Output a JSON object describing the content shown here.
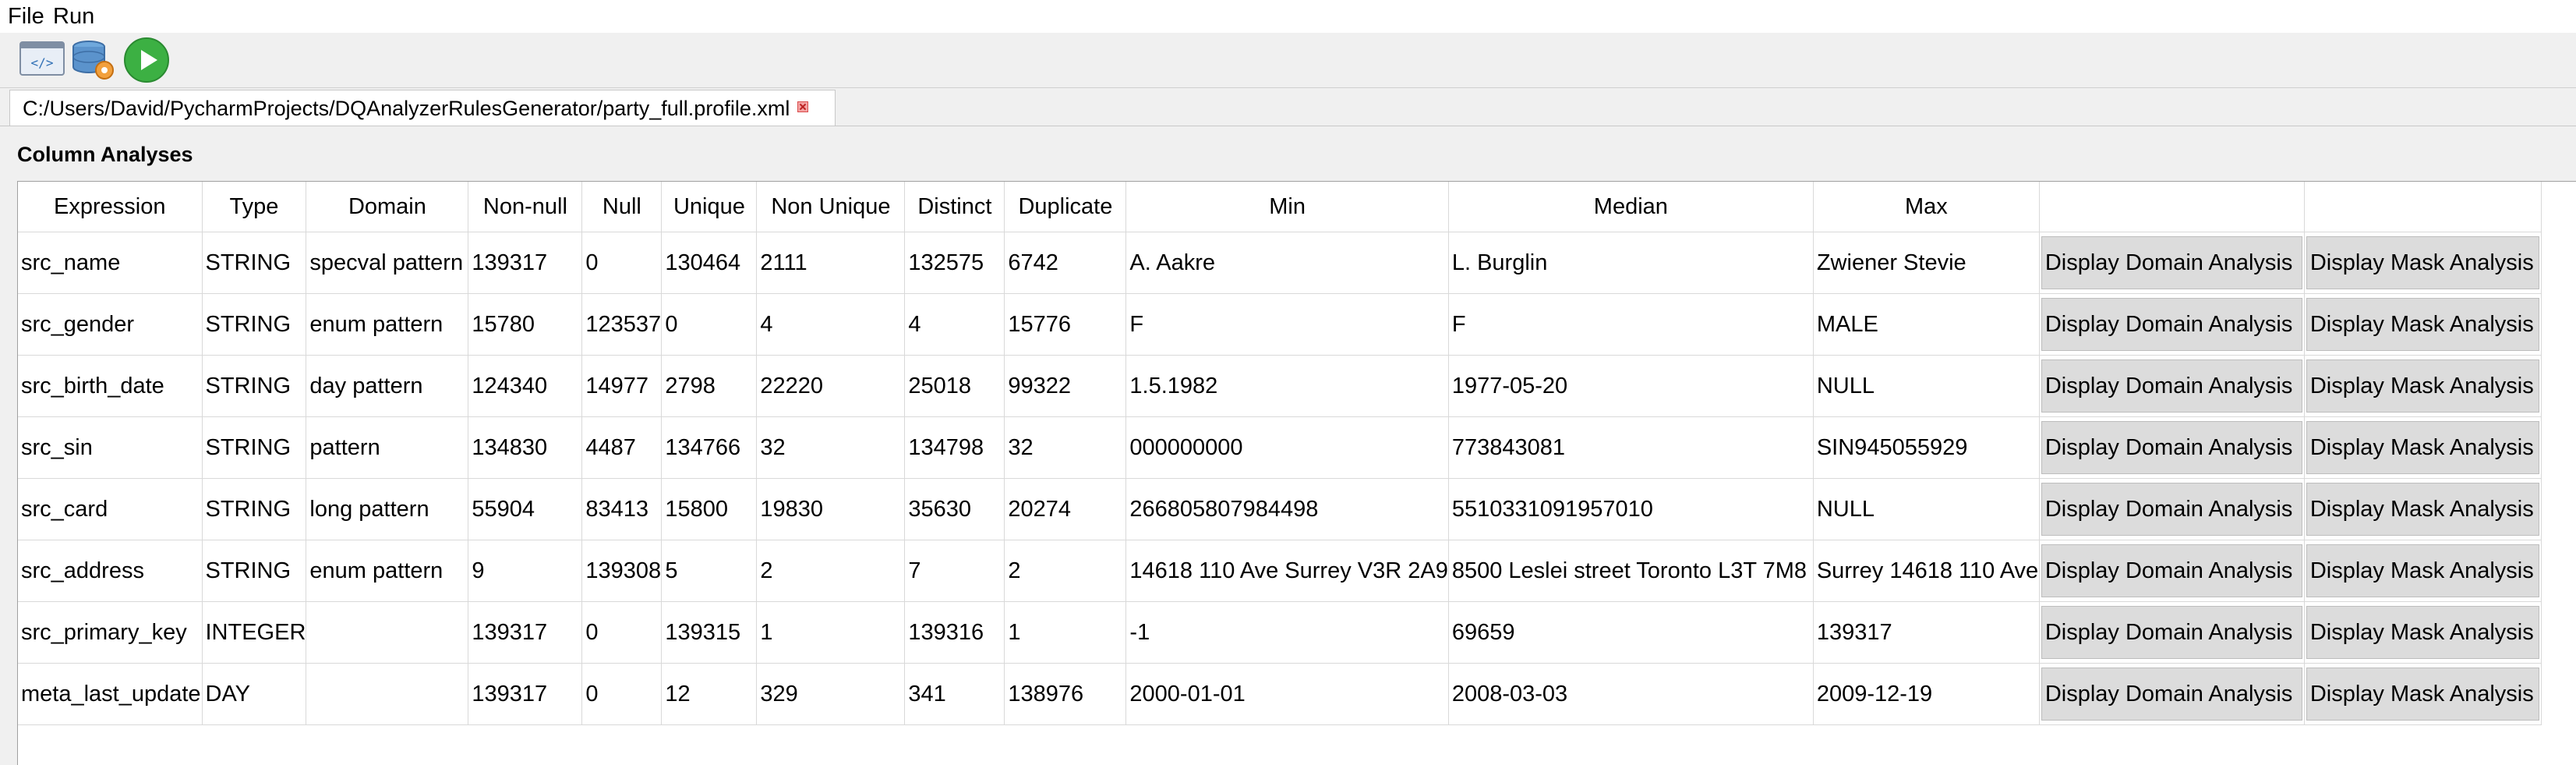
{
  "menu": {
    "items": [
      "File",
      "Run"
    ]
  },
  "toolbar": {
    "buttons": [
      "code-editor-icon",
      "database-settings-icon",
      "run-icon"
    ]
  },
  "tab": {
    "title": "C:/Users/David/PycharmProjects/DQAnalyzerRulesGenerator/party_full.profile.xml"
  },
  "section": {
    "title": "Column Analyses"
  },
  "table": {
    "headers": [
      "Expression",
      "Type",
      "Domain",
      "Non-null",
      "Null",
      "Unique",
      "Non Unique",
      "Distinct",
      "Duplicate",
      "Min",
      "Median",
      "Max",
      "",
      ""
    ],
    "rows": [
      {
        "cells": [
          "src_name",
          "STRING",
          "specval pattern",
          "139317",
          "0",
          "130464",
          "2111",
          "132575",
          "6742",
          "A. Aakre",
          "L. Burglin",
          "Zwiener Stevie"
        ],
        "btn1": "Display Domain Analysis",
        "btn2": "Display Mask Analysis"
      },
      {
        "cells": [
          "src_gender",
          "STRING",
          "enum pattern",
          "15780",
          "123537",
          "0",
          "4",
          "4",
          "15776",
          "F",
          "F",
          "MALE"
        ],
        "btn1": "Display Domain Analysis",
        "btn2": "Display Mask Analysis"
      },
      {
        "cells": [
          "src_birth_date",
          "STRING",
          "day pattern",
          "124340",
          "14977",
          "2798",
          "22220",
          "25018",
          "99322",
          "1.5.1982",
          "1977-05-20",
          "NULL"
        ],
        "btn1": "Display Domain Analysis",
        "btn2": "Display Mask Analysis"
      },
      {
        "cells": [
          "src_sin",
          "STRING",
          "pattern",
          "134830",
          "4487",
          "134766",
          "32",
          "134798",
          "32",
          "000000000",
          "773843081",
          "SIN945055929"
        ],
        "btn1": "Display Domain Analysis",
        "btn2": "Display Mask Analysis"
      },
      {
        "cells": [
          "src_card",
          "STRING",
          "long pattern",
          "55904",
          "83413",
          "15800",
          "19830",
          "35630",
          "20274",
          "266805807984498",
          "5510331091957010",
          "NULL"
        ],
        "btn1": "Display Domain Analysis",
        "btn2": "Display Mask Analysis"
      },
      {
        "cells": [
          "src_address",
          "STRING",
          "enum pattern",
          "9",
          "139308",
          "5",
          "2",
          "7",
          "2",
          "14618 110 Ave Surrey V3R 2A9",
          "8500 Leslei street Toronto L3T 7M8",
          "Surrey 14618 110 Ave"
        ],
        "btn1": "Display Domain Analysis",
        "btn2": "Display Mask Analysis"
      },
      {
        "cells": [
          "src_primary_key",
          "INTEGER",
          "",
          "139317",
          "0",
          "139315",
          "1",
          "139316",
          "1",
          "-1",
          "69659",
          "139317"
        ],
        "btn1": "Display Domain Analysis",
        "btn2": "Display Mask Analysis"
      },
      {
        "cells": [
          "meta_last_update",
          "DAY",
          "",
          "139317",
          "0",
          "12",
          "329",
          "341",
          "138976",
          "2000-01-01",
          "2008-03-03",
          "2009-12-19"
        ],
        "btn1": "Display Domain Analysis",
        "btn2": "Display Mask Analysis"
      }
    ]
  },
  "colors": {
    "menubar_bg": "#ffffff",
    "window_bg": "#f0f0f0",
    "button_bg": "#dcdcdc",
    "grid_line": "#d9d9d9",
    "run_green": "#3cb043"
  }
}
